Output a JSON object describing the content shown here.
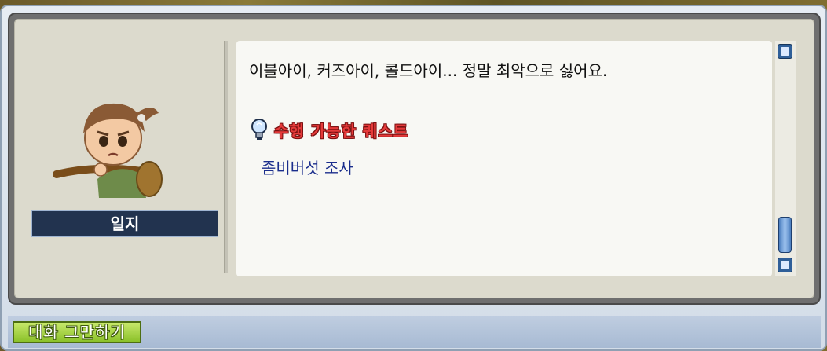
{
  "npc": {
    "name": "일지"
  },
  "dialog": {
    "message": "이블아이, 커즈아이, 콜드아이... 정말 최악으로 싫어요.",
    "quest_header": "수행 가능한 퀘스트",
    "quests": [
      "좀비버섯 조사"
    ]
  },
  "buttons": {
    "end_chat": "대화 그만하기"
  },
  "colors": {
    "quest_header": "#e53a3a",
    "quest_link": "#1a2d8c",
    "name_tag_bg": "#22334f",
    "end_chat_bg": "#8bc12a"
  }
}
